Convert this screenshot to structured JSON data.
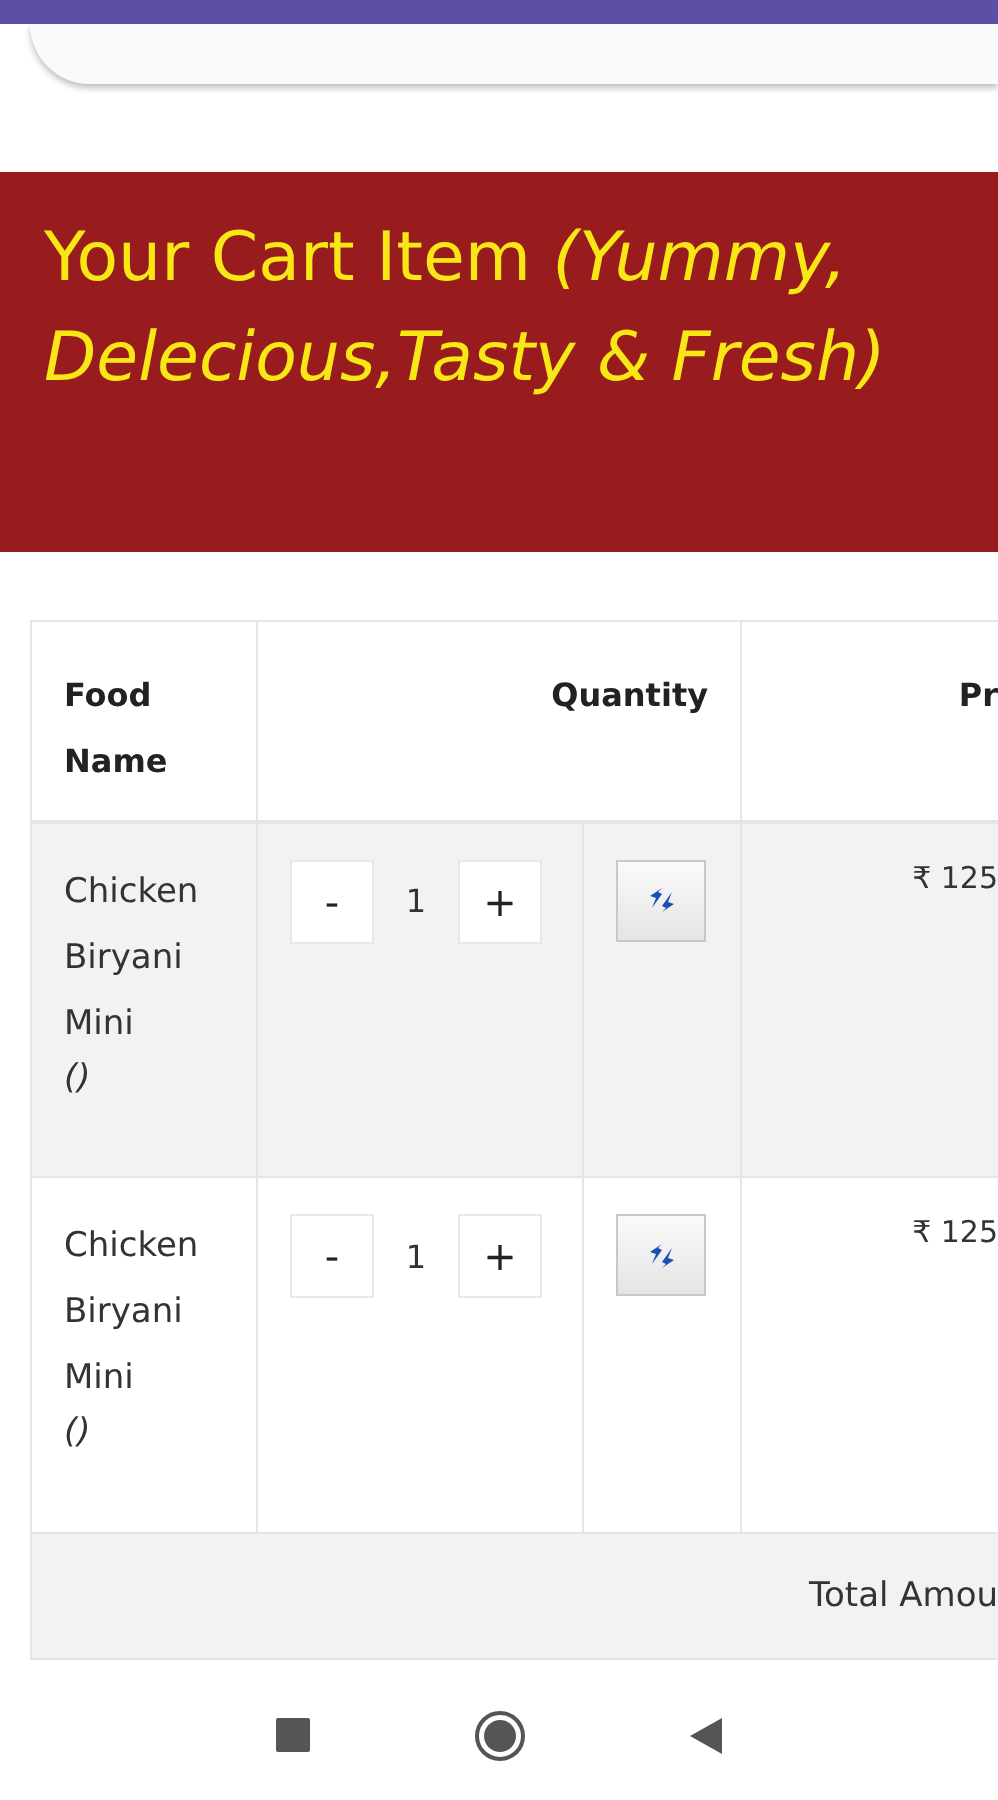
{
  "banner": {
    "title": "Your Cart Item *(Yummy, Delecious,Tasty & Fresh)*"
  },
  "table": {
    "columns": [
      "Food Name",
      "Quantity",
      "Pr"
    ],
    "rows": [
      {
        "name": "Chicken Biryani Mini",
        "note": "()",
        "minus": "-",
        "quantity": "1",
        "plus": "+",
        "price": "₹ 125",
        "shaded": true
      },
      {
        "name": "Chicken Biryani Mini",
        "note": "()",
        "minus": "-",
        "quantity": "1",
        "plus": "+",
        "price": "₹ 125",
        "shaded": false
      }
    ],
    "total_label": "Total Amou"
  }
}
